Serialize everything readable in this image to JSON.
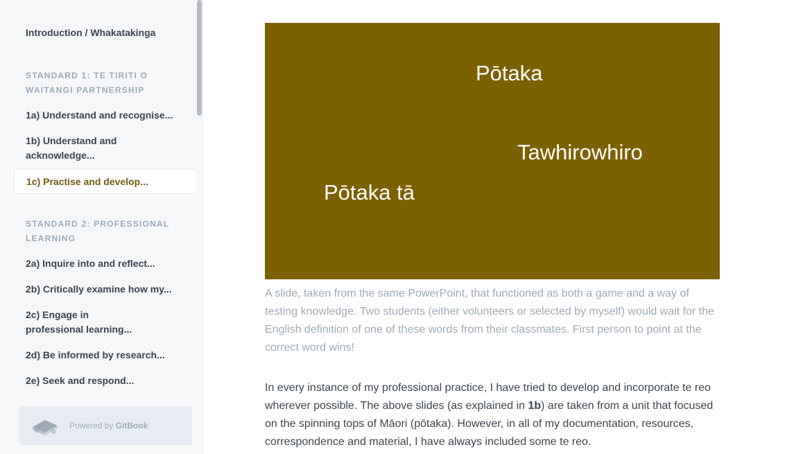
{
  "sidebar": {
    "intro": "Introduction / Whakatakinga",
    "sections": [
      {
        "title": "STANDARD 1: TE TIRITI O WAITANGI PARTNERSHIP",
        "items": [
          "1a) Understand and recognise...",
          "1b) Understand and acknowledge...",
          "1c) Practise and develop..."
        ]
      },
      {
        "title": "STANDARD 2: PROFESSIONAL LEARNING",
        "items": [
          "2a) Inquire into and reflect...",
          "2b) Critically examine how my...",
          "2c) Engage in professional learning...",
          "2d) Be informed by research...",
          "2e) Seek and respond..."
        ]
      }
    ],
    "active_item": "1c) Practise and develop...",
    "powered_by_prefix": "Powered by ",
    "powered_by_brand": "GitBook"
  },
  "slide": {
    "background": "#7d6000",
    "words": [
      "Pōtaka",
      "Tawhirowhiro",
      "Pōtaka tā"
    ]
  },
  "caption": "A slide, taken from the same PowerPoint, that functioned as both a game and a way of testing knowledge. Two students (either volunteers or selected by myself) would wait for the English definition of one of these words from their classmates. First person to point at the correct word wins!",
  "paragraph": {
    "before_bold": "In every instance of my professional practice, I have tried to develop and incorporate te reo wherever possible. The above slides (as explained in ",
    "bold": "1b",
    "after_bold": ") are taken from a unit that focused on the spinning tops of Māori (pōtaka). However, in all of my documentation, resources, correspondence and material, I have always included some te reo."
  },
  "colors": {
    "accent": "#735c0f",
    "sidebar_bg": "#f5f7f9",
    "text": "#3b454e",
    "muted": "#9daab6"
  }
}
